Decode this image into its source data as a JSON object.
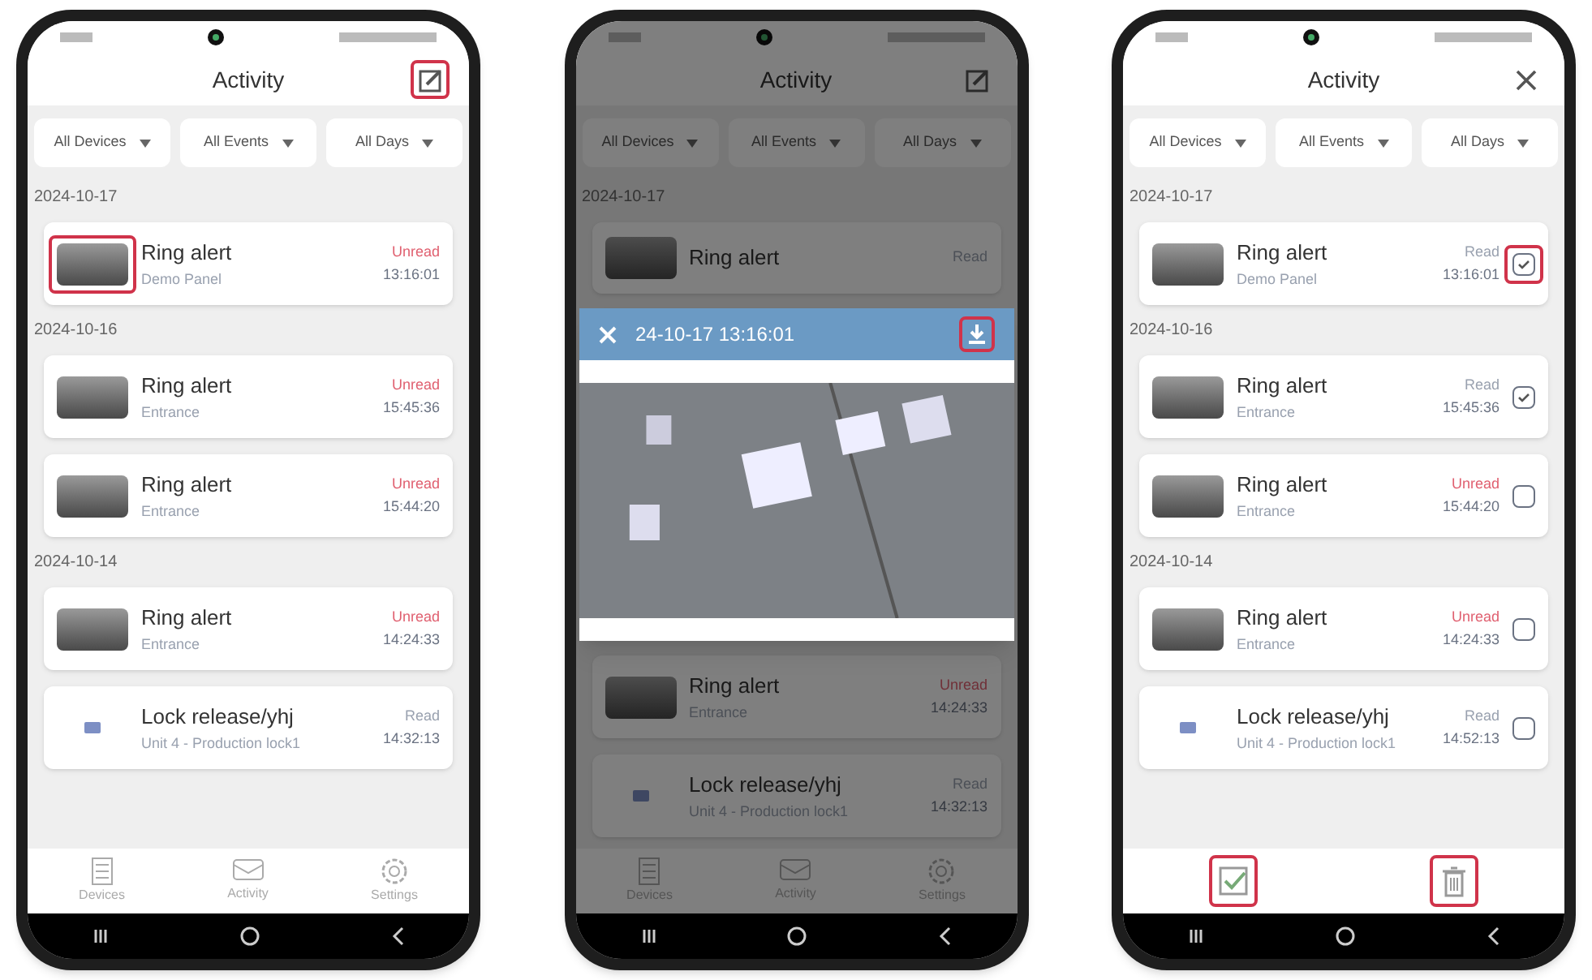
{
  "phones": [
    {
      "title": "Activity",
      "header_action": {
        "kind": "edit",
        "highlighted": true
      },
      "dimmed": false,
      "filters": [
        "All Devices",
        "All Events",
        "All Days"
      ],
      "sections": [
        {
          "kind": "date",
          "text": "2024-10-17"
        },
        {
          "kind": "camera",
          "title": "Ring alert",
          "subtitle": "Demo Panel",
          "status": "Unread",
          "unread": true,
          "time": "13:16:01",
          "highlighted": true
        },
        {
          "kind": "date",
          "text": "2024-10-16"
        },
        {
          "kind": "camera",
          "title": "Ring alert",
          "subtitle": "Entrance",
          "status": "Unread",
          "unread": true,
          "time": "15:45:36",
          "highlighted": false
        },
        {
          "kind": "camera",
          "title": "Ring alert",
          "subtitle": "Entrance",
          "status": "Unread",
          "unread": true,
          "time": "15:44:20",
          "highlighted": false
        },
        {
          "kind": "date",
          "text": "2024-10-14"
        },
        {
          "kind": "camera",
          "title": "Ring alert",
          "subtitle": "Entrance",
          "status": "Unread",
          "unread": true,
          "time": "14:24:33",
          "highlighted": false
        },
        {
          "kind": "lock",
          "title": "Lock release/yhj",
          "subtitle": "Unit 4 - Production lock1",
          "status": "Read",
          "unread": false,
          "time": "14:32:13",
          "highlighted": false
        }
      ],
      "bottom": {
        "kind": "nav",
        "items": [
          {
            "label": "Devices"
          },
          {
            "label": "Activity"
          },
          {
            "label": "Settings"
          }
        ]
      }
    },
    {
      "title": "Activity",
      "header_action": {
        "kind": "edit",
        "highlighted": false
      },
      "dimmed": true,
      "filters": [
        "All Devices",
        "All Events",
        "All Days"
      ],
      "sections": [
        {
          "kind": "date",
          "text": "2024-10-17"
        },
        {
          "kind": "camera",
          "title": "Ring alert",
          "status": "Read",
          "unread": false,
          "highlighted": false
        },
        {
          "kind": "viewer",
          "title": "24-10-17 13:16:01",
          "download_highlighted": true
        },
        {
          "kind": "camera",
          "title": "Ring alert",
          "subtitle": "Entrance",
          "status": "Unread",
          "unread": true,
          "time": "14:24:33",
          "highlighted": false
        },
        {
          "kind": "lock",
          "title": "Lock release/yhj",
          "subtitle": "Unit 4 - Production lock1",
          "status": "Read",
          "unread": false,
          "time": "14:32:13",
          "highlighted": false
        }
      ],
      "bottom": {
        "kind": "nav",
        "items": [
          {
            "label": "Devices"
          },
          {
            "label": "Activity"
          },
          {
            "label": "Settings"
          }
        ]
      }
    },
    {
      "title": "Activity",
      "header_action": {
        "kind": "close",
        "highlighted": false
      },
      "dimmed": false,
      "filters": [
        "All Devices",
        "All Events",
        "All Days"
      ],
      "sections": [
        {
          "kind": "date",
          "text": "2024-10-17"
        },
        {
          "kind": "camera",
          "title": "Ring alert",
          "subtitle": "Demo Panel",
          "status": "Read",
          "unread": false,
          "time": "13:16:01",
          "checked": true,
          "highlighted": false,
          "check_highlighted": true
        },
        {
          "kind": "date",
          "text": "2024-10-16"
        },
        {
          "kind": "camera",
          "title": "Ring alert",
          "subtitle": "Entrance",
          "status": "Read",
          "unread": false,
          "time": "15:45:36",
          "checked": true,
          "highlighted": false,
          "check_highlighted": false
        },
        {
          "kind": "camera",
          "title": "Ring alert",
          "subtitle": "Entrance",
          "status": "Unread",
          "unread": true,
          "time": "15:44:20",
          "checked": false,
          "highlighted": false,
          "check_highlighted": false
        },
        {
          "kind": "date",
          "text": "2024-10-14"
        },
        {
          "kind": "camera",
          "title": "Ring alert",
          "subtitle": "Entrance",
          "status": "Unread",
          "unread": true,
          "time": "14:24:33",
          "checked": false,
          "highlighted": false,
          "check_highlighted": false
        },
        {
          "kind": "lock",
          "title": "Lock release/yhj",
          "subtitle": "Unit 4 - Production lock1",
          "status": "Read",
          "unread": false,
          "time": "14:52:13",
          "checked": false,
          "highlighted": false,
          "check_highlighted": false
        }
      ],
      "bottom": {
        "kind": "actions",
        "items": [
          {
            "kind": "select_all",
            "highlighted": true
          },
          {
            "kind": "delete",
            "highlighted": true
          }
        ]
      }
    }
  ]
}
